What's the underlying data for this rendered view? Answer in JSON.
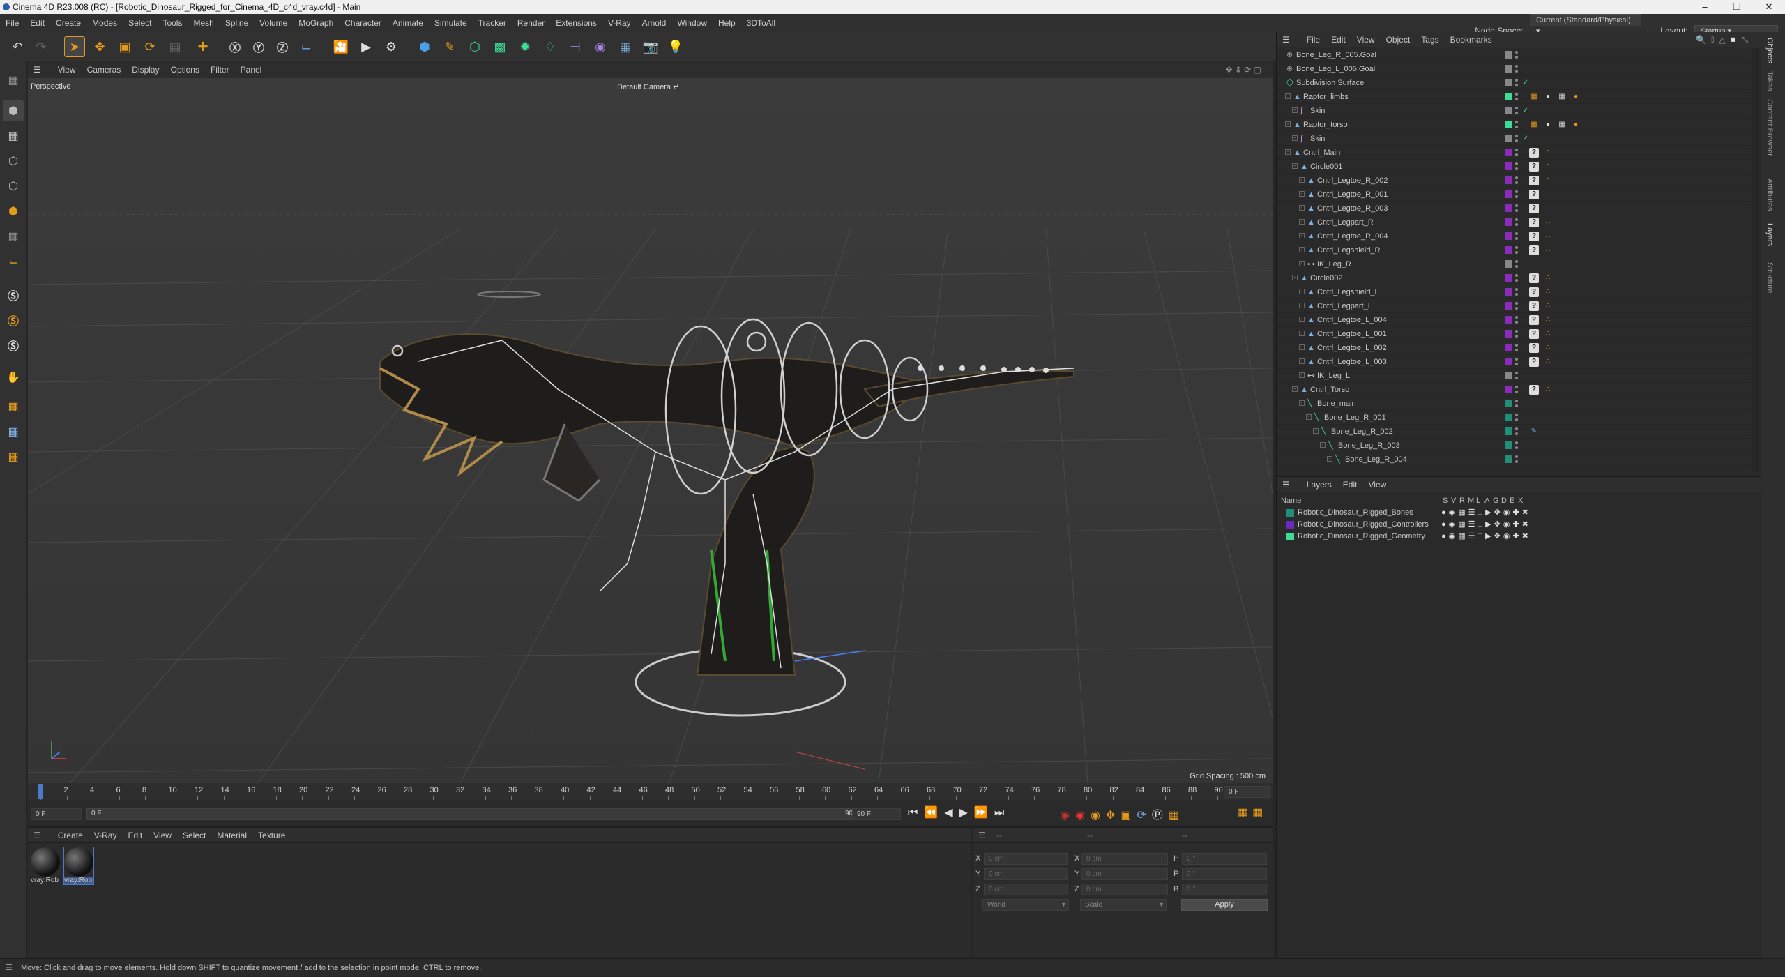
{
  "title": "Cinema 4D R23.008 (RC) - [Robotic_Dinosaur_Rigged_for_Cinema_4D_c4d_vray.c4d] - Main",
  "menu": [
    "File",
    "Edit",
    "Create",
    "Modes",
    "Select",
    "Tools",
    "Mesh",
    "Spline",
    "Volume",
    "MoGraph",
    "Character",
    "Animate",
    "Simulate",
    "Tracker",
    "Render",
    "Extensions",
    "V-Ray",
    "Arnold",
    "Window",
    "Help",
    "3DToAll"
  ],
  "node_space_label": "Node Space:",
  "node_space_value": "Current (Standard/Physical)",
  "layout_label": "Layout:",
  "layout_value": "Startup",
  "viewport": {
    "menu": [
      "View",
      "Cameras",
      "Display",
      "Options",
      "Filter",
      "Panel"
    ],
    "name": "Perspective",
    "camera": "Default Camera",
    "grid_spacing": "Grid Spacing : 500 cm"
  },
  "timeline": {
    "ticks": [
      "0",
      "2",
      "4",
      "6",
      "8",
      "10",
      "12",
      "14",
      "16",
      "18",
      "20",
      "22",
      "24",
      "26",
      "28",
      "30",
      "32",
      "34",
      "36",
      "38",
      "40",
      "42",
      "44",
      "46",
      "48",
      "50",
      "52",
      "54",
      "56",
      "58",
      "60",
      "62",
      "64",
      "66",
      "68",
      "70",
      "72",
      "74",
      "76",
      "78",
      "80",
      "82",
      "84",
      "86",
      "88",
      "90"
    ],
    "current_frame": "0 F",
    "start": "0 F",
    "range_start": "0 F",
    "range_end": "90 F",
    "end": "90 F"
  },
  "materials": {
    "menu": [
      "Create",
      "V-Ray",
      "Edit",
      "View",
      "Select",
      "Material",
      "Texture"
    ],
    "items": [
      "vray:Rob",
      "vray:Rob"
    ]
  },
  "coords": {
    "header": [
      "--",
      "--",
      "--"
    ],
    "rows": [
      {
        "a": "X",
        "av": "0 cm",
        "b": "X",
        "bv": "0 cm",
        "c": "H",
        "cv": "0 °"
      },
      {
        "a": "Y",
        "av": "0 cm",
        "b": "Y",
        "bv": "0 cm",
        "c": "P",
        "cv": "0 °"
      },
      {
        "a": "Z",
        "av": "0 cm",
        "b": "Z",
        "bv": "0 cm",
        "c": "B",
        "cv": "0 °"
      }
    ],
    "mode1": "World",
    "mode2": "Scale",
    "apply": "Apply"
  },
  "status": "Move: Click and drag to move elements. Hold down SHIFT to quantize movement / add to the selection in point mode, CTRL to remove.",
  "objects": {
    "menu": [
      "File",
      "Edit",
      "View",
      "Object",
      "Tags",
      "Bookmarks"
    ],
    "rows": [
      {
        "name": "Bone_Leg_R_005.Goal",
        "indent": 0,
        "icon": "null",
        "color": "#888888",
        "tags": "none"
      },
      {
        "name": "Bone_Leg_L_005.Goal",
        "indent": 0,
        "icon": "null",
        "color": "#888888",
        "tags": "none"
      },
      {
        "name": "Subdivision Surface",
        "indent": 0,
        "icon": "subdiv",
        "color": "#888888",
        "tags": "check"
      },
      {
        "name": "Raptor_limbs",
        "indent": 1,
        "icon": "obj",
        "color": "#3ddc97",
        "tags": "mat"
      },
      {
        "name": "Skin",
        "indent": 2,
        "icon": "skin",
        "color": "#888888",
        "tags": "check"
      },
      {
        "name": "Raptor_torso",
        "indent": 1,
        "icon": "obj",
        "color": "#3ddc97",
        "tags": "mat"
      },
      {
        "name": "Skin",
        "indent": 2,
        "icon": "skin",
        "color": "#888888",
        "tags": "check"
      },
      {
        "name": "Cntrl_Main",
        "indent": 1,
        "icon": "ctrl",
        "color": "#8a2bbd",
        "tags": "q"
      },
      {
        "name": "Circle001",
        "indent": 2,
        "icon": "ctrl",
        "color": "#8a2bbd",
        "tags": "q"
      },
      {
        "name": "Cntrl_Legtoe_R_002",
        "indent": 3,
        "icon": "ctrl",
        "color": "#8a2bbd",
        "tags": "q"
      },
      {
        "name": "Cntrl_Legtoe_R_001",
        "indent": 3,
        "icon": "ctrl",
        "color": "#8a2bbd",
        "tags": "q"
      },
      {
        "name": "Cntrl_Legtoe_R_003",
        "indent": 3,
        "icon": "ctrl",
        "color": "#8a2bbd",
        "tags": "q"
      },
      {
        "name": "Cntrl_Legpart_R",
        "indent": 3,
        "icon": "ctrl",
        "color": "#8a2bbd",
        "tags": "q"
      },
      {
        "name": "Cntrl_Legtoe_R_004",
        "indent": 3,
        "icon": "ctrl",
        "color": "#8a2bbd",
        "tags": "q"
      },
      {
        "name": "Cntrl_Legshield_R",
        "indent": 3,
        "icon": "ctrl",
        "color": "#8a2bbd",
        "tags": "q"
      },
      {
        "name": "IK_Leg_R",
        "indent": 3,
        "icon": "ik",
        "color": "#888888",
        "tags": "none"
      },
      {
        "name": "Circle002",
        "indent": 2,
        "icon": "ctrl",
        "color": "#8a2bbd",
        "tags": "q"
      },
      {
        "name": "Cntrl_Legshield_L",
        "indent": 3,
        "icon": "ctrl",
        "color": "#8a2bbd",
        "tags": "q"
      },
      {
        "name": "Cntrl_Legpart_L",
        "indent": 3,
        "icon": "ctrl",
        "color": "#8a2bbd",
        "tags": "q"
      },
      {
        "name": "Cntrl_Legtoe_L_004",
        "indent": 3,
        "icon": "ctrl",
        "color": "#8a2bbd",
        "tags": "q"
      },
      {
        "name": "Cntrl_Legtoe_L_001",
        "indent": 3,
        "icon": "ctrl",
        "color": "#8a2bbd",
        "tags": "q"
      },
      {
        "name": "Cntrl_Legtoe_L_002",
        "indent": 3,
        "icon": "ctrl",
        "color": "#8a2bbd",
        "tags": "q"
      },
      {
        "name": "Cntrl_Legtoe_L_003",
        "indent": 3,
        "icon": "ctrl",
        "color": "#8a2bbd",
        "tags": "q"
      },
      {
        "name": "IK_Leg_L",
        "indent": 3,
        "icon": "ik",
        "color": "#888888",
        "tags": "none"
      },
      {
        "name": "Cntrl_Torso",
        "indent": 2,
        "icon": "ctrl",
        "color": "#8a2bbd",
        "tags": "q"
      },
      {
        "name": "Bone_main",
        "indent": 3,
        "icon": "bone",
        "color": "#1f8f7a",
        "tags": "none"
      },
      {
        "name": "Bone_Leg_R_001",
        "indent": 4,
        "icon": "bone",
        "color": "#1f8f7a",
        "tags": "none"
      },
      {
        "name": "Bone_Leg_R_002",
        "indent": 5,
        "icon": "bone",
        "color": "#1f8f7a",
        "tags": "ikpen"
      },
      {
        "name": "Bone_Leg_R_003",
        "indent": 6,
        "icon": "bone",
        "color": "#1f8f7a",
        "tags": "none"
      },
      {
        "name": "Bone_Leg_R_004",
        "indent": 7,
        "icon": "bone",
        "color": "#1f8f7a",
        "tags": "none"
      }
    ]
  },
  "layers": {
    "menu": [
      "Layers",
      "Edit",
      "View"
    ],
    "cols": [
      "Name",
      "S",
      "V",
      "R",
      "M",
      "L",
      "A",
      "G",
      "D",
      "E",
      "X"
    ],
    "rows": [
      {
        "name": "Robotic_Dinosaur_Rigged_Bones",
        "color": "#1f8f7a"
      },
      {
        "name": "Robotic_Dinosaur_Rigged_Controllers",
        "color": "#6a2bbd"
      },
      {
        "name": "Robotic_Dinosaur_Rigged_Geometry",
        "color": "#3ddc97"
      }
    ]
  },
  "right_tabs": [
    "Objects",
    "Takes",
    "Content Browser",
    "Attributes",
    "Layers",
    "Structure"
  ]
}
